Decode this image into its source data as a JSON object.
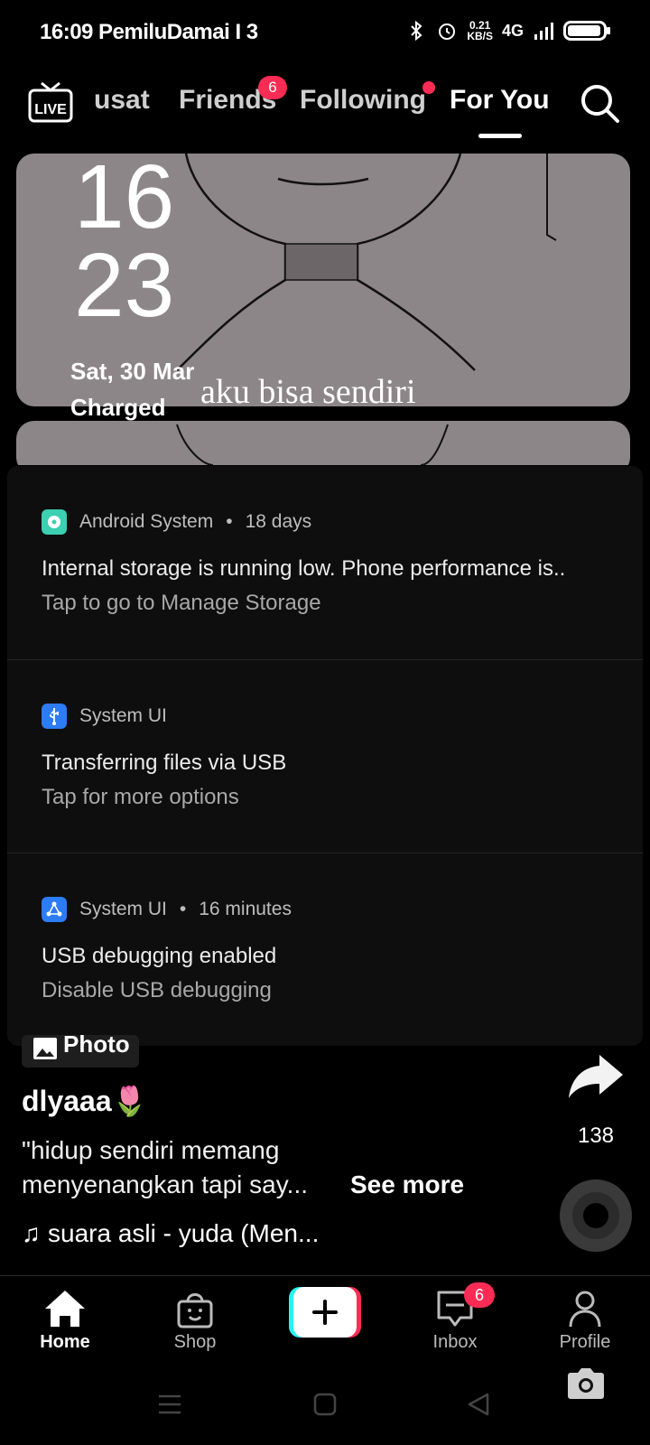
{
  "status_bar": {
    "left_text": "16:09 PemiluDamai I 3",
    "net_speed": "0.21",
    "net_unit": "KB/S",
    "network": "4G",
    "battery_percent": 95
  },
  "top_nav": {
    "live_label": "LIVE",
    "tabs": [
      {
        "label": "usat"
      },
      {
        "label": "Friends"
      },
      {
        "label": "Following"
      },
      {
        "label": "For You"
      }
    ],
    "friends_badge": "6"
  },
  "video": {
    "clock_hour": "16",
    "clock_minute": "23",
    "date": "Sat, 30 Mar",
    "charge_status": "Charged",
    "overlay_caption": "aku bisa sendiri"
  },
  "notifications": [
    {
      "app": "Android System",
      "time": "18 days",
      "title": "Internal storage is running low. Phone performance is..",
      "subtitle": "Tap to go to Manage Storage",
      "icon": "storage-icon",
      "icon_color": "#3ccfb2"
    },
    {
      "app": "System UI",
      "time": "",
      "title": "Transferring files via USB",
      "subtitle": "Tap for more options",
      "icon": "usb-icon",
      "icon_color": "#2c7cf6"
    },
    {
      "app": "System UI",
      "time": "16 minutes",
      "title": "USB debugging enabled",
      "subtitle": "Disable USB debugging",
      "icon": "debug-icon",
      "icon_color": "#2c7cf6"
    }
  ],
  "post": {
    "photo_tag": "Photo",
    "username": "dlyaaa🌷",
    "description_line1": "\"hidup sendiri memang",
    "description_line2": "menyenangkan tapi say...",
    "see_more": "See more",
    "music": "suara asli - yuda (Men..."
  },
  "actions": {
    "share_count": "138"
  },
  "bottom_nav": {
    "items": [
      {
        "label": "Home",
        "icon": "home-icon"
      },
      {
        "label": "Shop",
        "icon": "shop-icon"
      },
      {
        "label": "",
        "icon": "create-icon"
      },
      {
        "label": "Inbox",
        "icon": "inbox-icon"
      },
      {
        "label": "Profile",
        "icon": "profile-icon"
      }
    ],
    "inbox_badge": "6"
  },
  "colors": {
    "accent": "#fe2c55",
    "background": "#000000",
    "panel": "#0e0e0e"
  }
}
